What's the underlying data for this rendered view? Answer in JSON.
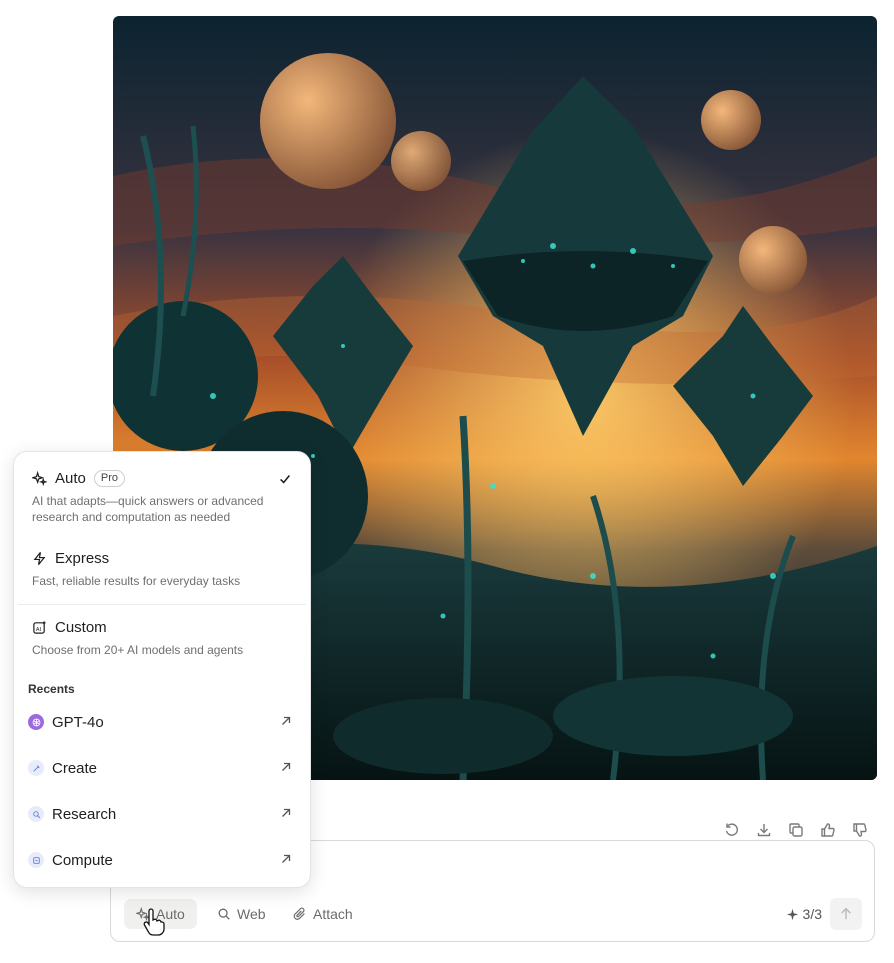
{
  "image": {
    "alt": ""
  },
  "actions": [
    {
      "icon": "regenerate-icon"
    },
    {
      "icon": "download-icon"
    },
    {
      "icon": "copy-icon"
    },
    {
      "icon": "thumbs-up-icon"
    },
    {
      "icon": "thumbs-down-icon"
    }
  ],
  "composer": {
    "placeholder": "",
    "tools": {
      "auto": "Auto",
      "web": "Web",
      "attach": "Attach"
    },
    "counter": "3/3"
  },
  "menu": {
    "options": [
      {
        "label": "Auto",
        "badge": "Pro",
        "description": "AI that adapts—quick answers or advanced research and computation as needed",
        "selected": true
      },
      {
        "label": "Express",
        "description": "Fast, reliable results for everyday tasks"
      },
      {
        "label": "Custom",
        "description": "Choose from 20+ AI models and agents"
      }
    ],
    "recents_title": "Recents",
    "recents": [
      {
        "label": "GPT-4o",
        "color": "#9b6bdc"
      },
      {
        "label": "Create",
        "color": "#e7ecfb"
      },
      {
        "label": "Research",
        "color": "#e7ecfb"
      },
      {
        "label": "Compute",
        "color": "#e7ecfb"
      }
    ]
  },
  "colors": {
    "accent_dark": "#1f1f1f",
    "muted": "#6f6f6f",
    "border": "#d9d9d9"
  }
}
